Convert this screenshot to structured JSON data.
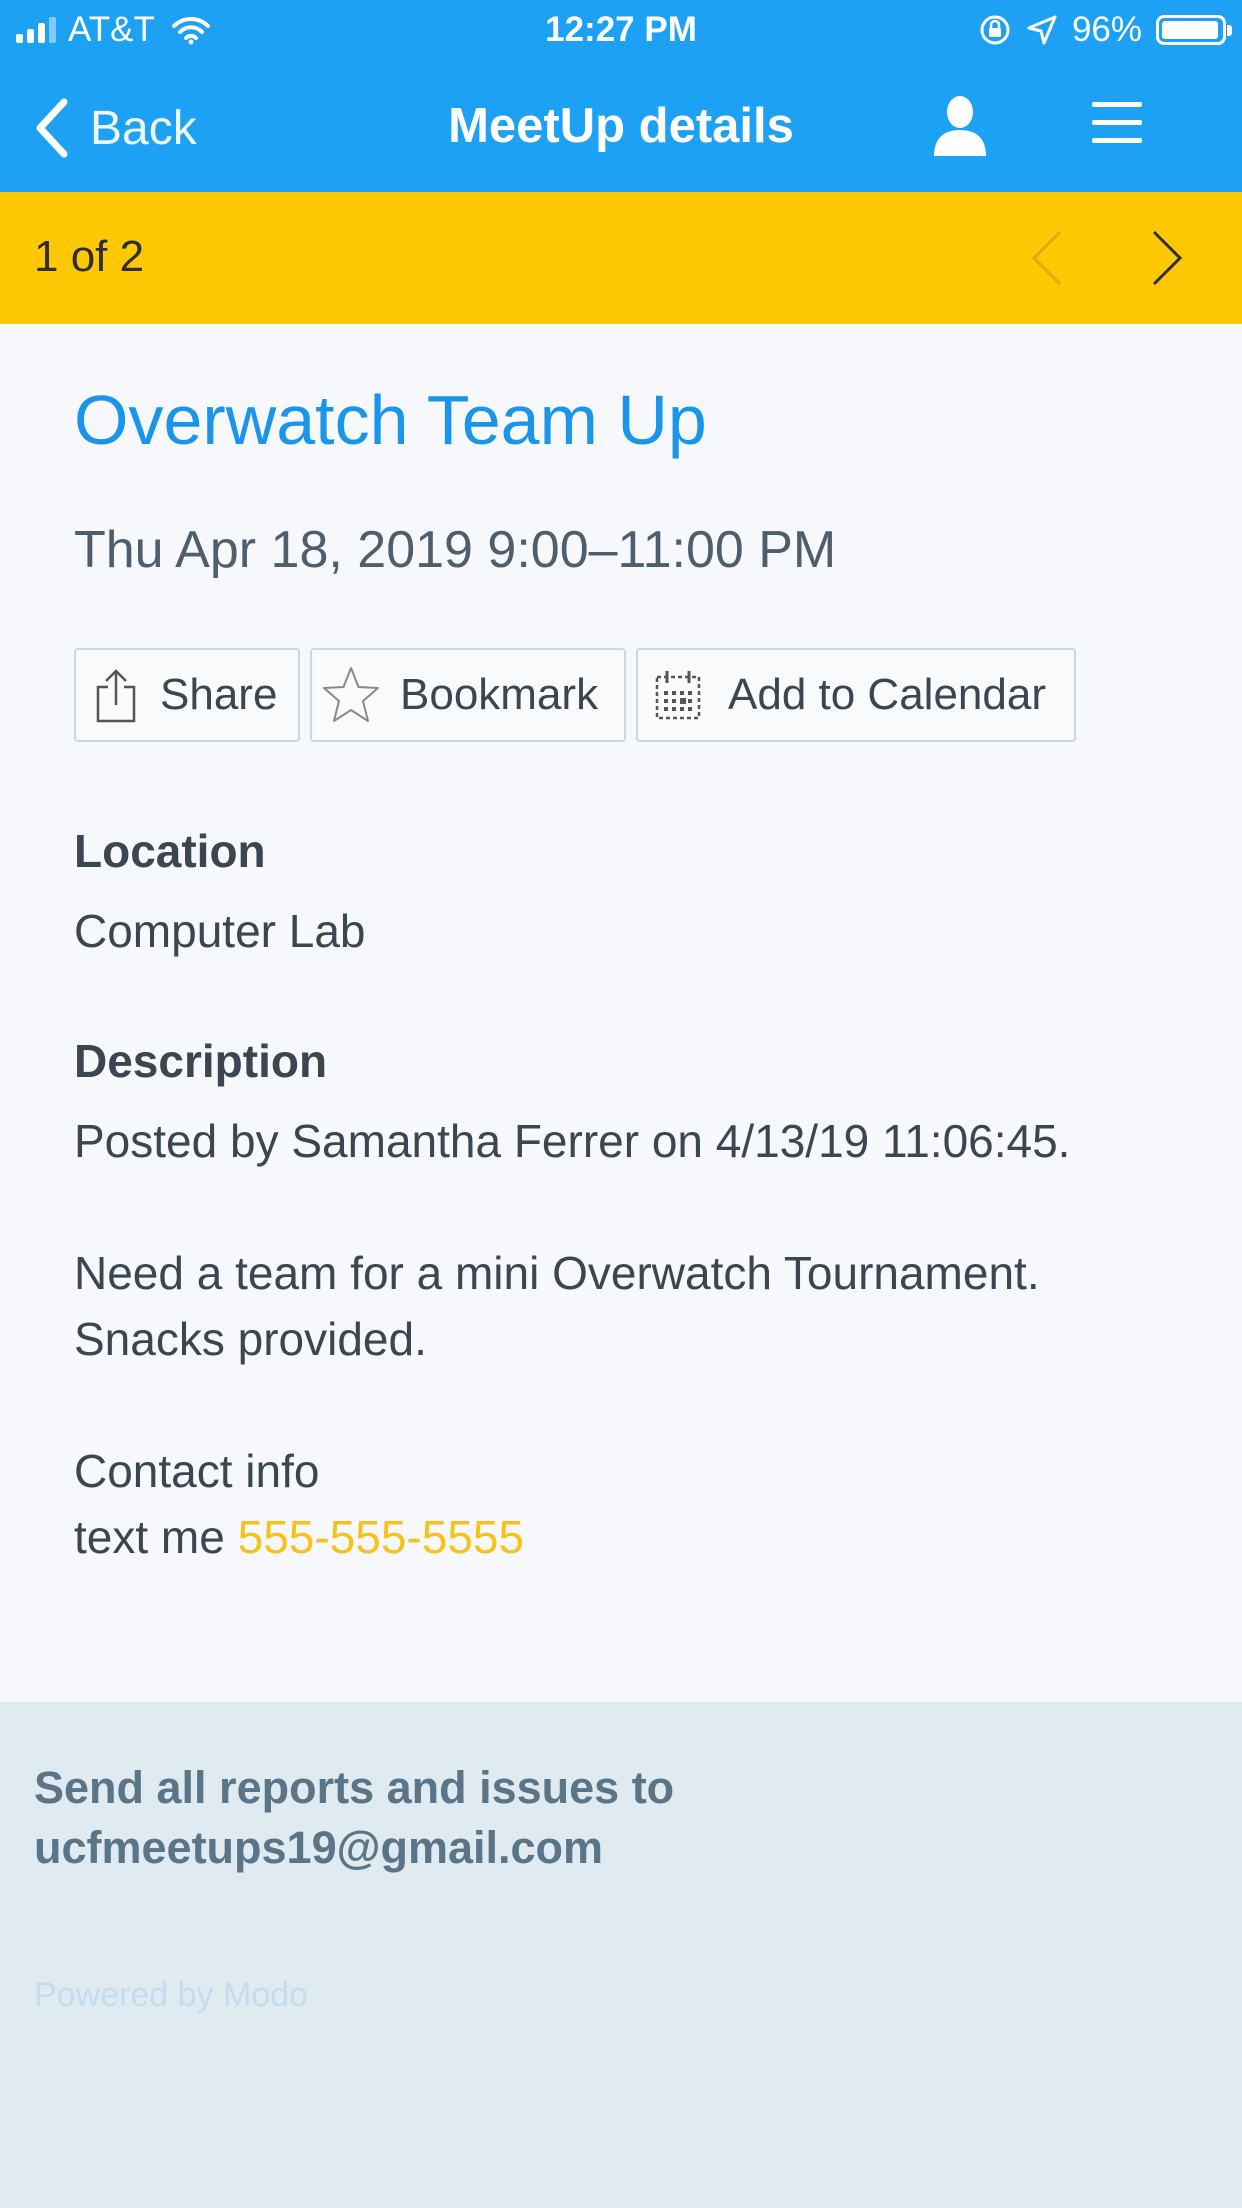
{
  "status_bar": {
    "carrier": "AT&T",
    "time": "12:27 PM",
    "battery": "96%"
  },
  "nav": {
    "back_label": "Back",
    "title": "MeetUp details",
    "user_icon": "user-icon",
    "menu_icon": "hamburger-menu-icon"
  },
  "pager": {
    "counter": "1 of 2"
  },
  "event": {
    "title": "Overwatch Team Up",
    "datetime": "Thu Apr 18, 2019 9:00–11:00 PM",
    "actions": {
      "share": "Share",
      "bookmark": "Bookmark",
      "calendar": "Add to Calendar"
    },
    "location_heading": "Location",
    "location": "Computer Lab",
    "description_heading": "Description",
    "posted_by": "Posted by Samantha Ferrer on 4/13/19 11:06:45.",
    "body_line1": "Need a team for a mini Overwatch Tournament.",
    "body_line2": "Snacks provided.",
    "contact_label": "Contact info",
    "contact_prefix": "text me ",
    "phone": "555-555-5555"
  },
  "footer": {
    "report_line1": "Send all reports and issues to",
    "report_line2": "ucfmeetups19@gmail.com",
    "powered": "Powered by Modo"
  },
  "colors": {
    "header_blue": "#1da1f5",
    "pager_yellow": "#fec805",
    "title_blue": "#1a95ea",
    "phone_yellow": "#f8c21a",
    "footer_bg": "#e0eaf1"
  }
}
